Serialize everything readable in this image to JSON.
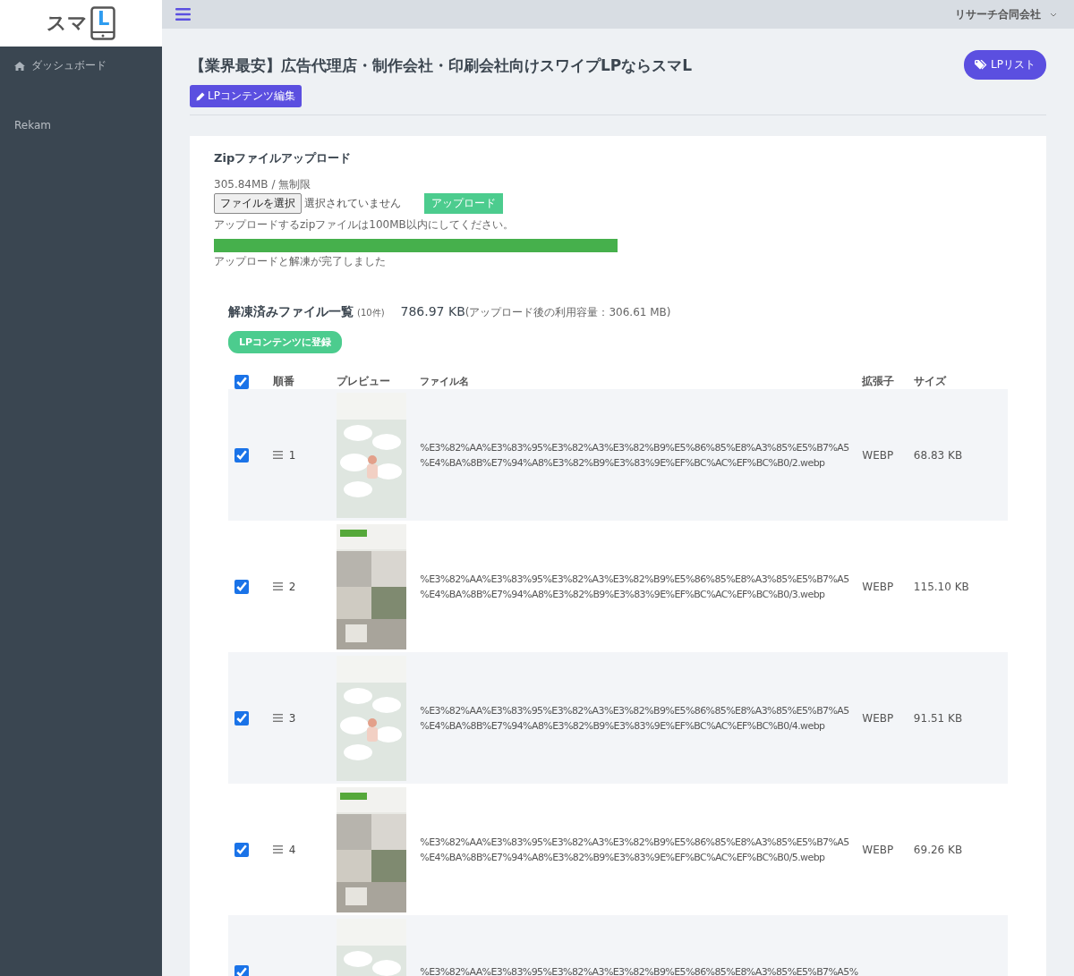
{
  "logo": {
    "text": "スマ",
    "letter": "L"
  },
  "sidebar": {
    "items": [
      {
        "label": "ダッシュボード"
      },
      {
        "label": "Rekam"
      }
    ]
  },
  "topbar": {
    "account": "リサーチ合同会社"
  },
  "page": {
    "title": "【業界最安】広告代理店・制作会社・印刷会社向けスワイプLPならスマL",
    "edit_button": "LPコンテンツ編集",
    "list_button": "LPリスト"
  },
  "upload": {
    "title": "Zipファイルアップロード",
    "usage": "305.84MB / 無制限",
    "file_button": "ファイルを選択",
    "file_status": "選択されていません",
    "upload_button": "アップロード",
    "note": "アップロードするzipファイルは100MB以内にしてください。",
    "progress": {
      "level": 1
    },
    "status": "アップロードと解凍が完了しました"
  },
  "files": {
    "title": "解凍済みファイル一覧",
    "count": "(10件)",
    "total": "786.97 KB",
    "total_note": "(アップロード後の利用容量：306.61 MB)",
    "register_button": "LPコンテンツに登録",
    "select_all": {
      "checked": true
    },
    "columns": [
      "順番",
      "プレビュー",
      "ファイル名",
      "拡張子",
      "サイズ"
    ],
    "rows": [
      {
        "checked": true,
        "order": "1",
        "name": "%E3%82%AA%E3%83%95%E3%82%A3%E3%82%B9%E5%86%85%E8%A3%85%E5%B7%A5%E4%BA%8B%E7%94%A8%E3%82%B9%E3%83%9E%EF%BC%AC%EF%BC%B0/2.webp",
        "ext": "WEBP",
        "size": "68.83 KB"
      },
      {
        "checked": true,
        "order": "2",
        "name": "%E3%82%AA%E3%83%95%E3%82%A3%E3%82%B9%E5%86%85%E8%A3%85%E5%B7%A5%E4%BA%8B%E7%94%A8%E3%82%B9%E3%83%9E%EF%BC%AC%EF%BC%B0/3.webp",
        "ext": "WEBP",
        "size": "115.10 KB"
      },
      {
        "checked": true,
        "order": "3",
        "name": "%E3%82%AA%E3%83%95%E3%82%A3%E3%82%B9%E5%86%85%E8%A3%85%E5%B7%A5%E4%BA%8B%E7%94%A8%E3%82%B9%E3%83%9E%EF%BC%AC%EF%BC%B0/4.webp",
        "ext": "WEBP",
        "size": "91.51 KB"
      },
      {
        "checked": true,
        "order": "4",
        "name": "%E3%82%AA%E3%83%95%E3%82%A3%E3%82%B9%E5%86%85%E8%A3%85%E5%B7%A5%E4%BA%8B%E7%94%A8%E3%82%B9%E3%83%9E%EF%BC%AC%EF%BC%B0/5.webp",
        "ext": "WEBP",
        "size": "69.26 KB"
      },
      {
        "checked": true,
        "name": "%E3%82%AA%E3%83%95%E3%82%A3%E3%82%B9%E5%86%85%E8%A3%85%E5%B7%A5%"
      }
    ]
  }
}
